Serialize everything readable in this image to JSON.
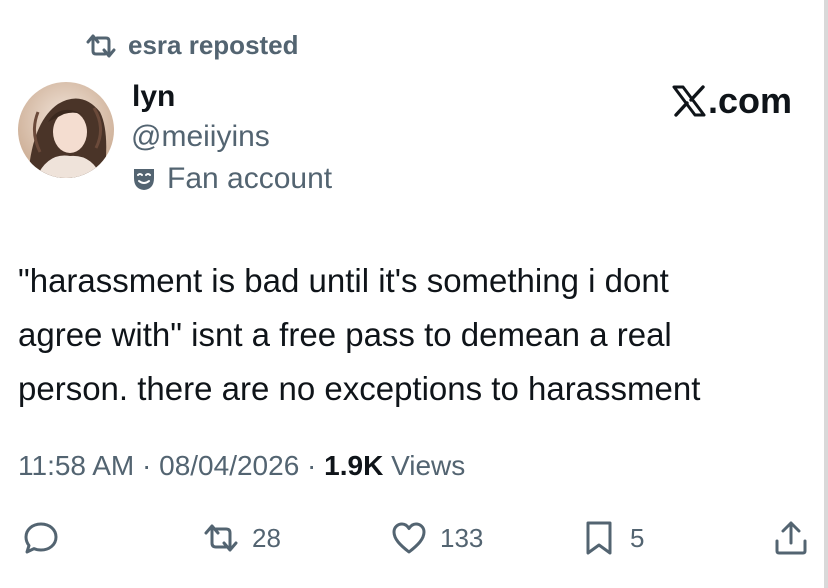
{
  "repost": {
    "text": "esra reposted",
    "icon": "repost-icon"
  },
  "author": {
    "display_name": "lyn",
    "handle": "@meiiyins",
    "account_label": "Fan account",
    "label_icon": "theater-mask-icon",
    "avatar": "avatar"
  },
  "brand": {
    "text": ".com",
    "icon": "x-logo-icon"
  },
  "tweet": {
    "text": "\"harassment is bad until it's something i dont\nagree with\" isnt a free pass to demean a real\nperson. there are no exceptions to harassment"
  },
  "meta": {
    "time": "11:58 AM",
    "separator": "·",
    "date": "08/04/2026",
    "views_count": "1.9K",
    "views_label": "Views"
  },
  "actions": {
    "reply": {
      "icon": "reply-icon",
      "count": ""
    },
    "repost": {
      "icon": "repost-icon",
      "count": "28"
    },
    "like": {
      "icon": "heart-icon",
      "count": "133"
    },
    "bookmark": {
      "icon": "bookmark-icon",
      "count": "5"
    },
    "share": {
      "icon": "share-icon"
    }
  },
  "colors": {
    "text_primary": "#0f1419",
    "text_secondary": "#536471",
    "background": "#ffffff"
  }
}
